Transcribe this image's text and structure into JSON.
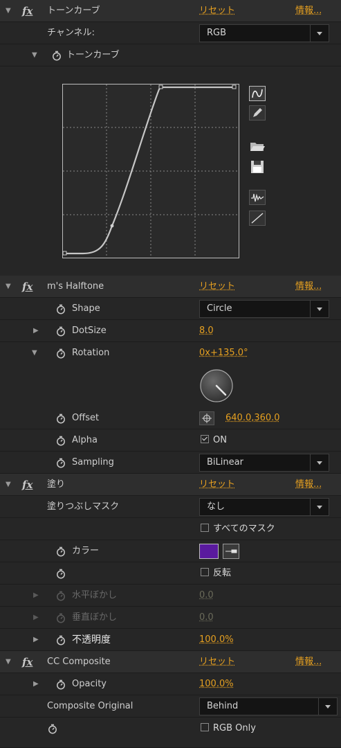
{
  "tone_curve": {
    "fx": "fx",
    "name": "トーンカーブ",
    "reset": "リセット",
    "about": "情報...",
    "channel_label": "チャンネル:",
    "channel_value": "RGB",
    "curve_label": "トーンカーブ"
  },
  "halftone": {
    "fx": "fx",
    "name": "m's Halftone",
    "reset": "リセット",
    "about": "情報...",
    "shape_label": "Shape",
    "shape_value": "Circle",
    "dotsize_label": "DotSize",
    "dotsize_value": "8.0",
    "rotation_label": "Rotation",
    "rotation_value": "0x+135.0°",
    "offset_label": "Offset",
    "offset_value": "640.0,360.0",
    "alpha_label": "Alpha",
    "alpha_value": "ON",
    "sampling_label": "Sampling",
    "sampling_value": "BiLinear"
  },
  "fill": {
    "fx": "fx",
    "name": "塗り",
    "reset": "リセット",
    "about": "情報...",
    "mask_label": "塗りつぶしマスク",
    "mask_value": "なし",
    "all_masks": "すべてのマスク",
    "color_label": "カラー",
    "color": "#5a1a9e",
    "invert": "反転",
    "h_feather_label": "水平ぼかし",
    "h_feather_value": "0.0",
    "v_feather_label": "垂直ぼかし",
    "v_feather_value": "0.0",
    "opacity_label": "不透明度",
    "opacity_value": "100.0%"
  },
  "cc_composite": {
    "fx": "fx",
    "name": "CC Composite",
    "reset": "リセット",
    "about": "情報...",
    "opacity_label": "Opacity",
    "opacity_value": "100.0%",
    "composite_label": "Composite Original",
    "composite_value": "Behind",
    "rgb_only": "RGB Only"
  },
  "colors": {
    "link": "#e6a020",
    "background": "#262626",
    "header": "#2e2e2e"
  }
}
